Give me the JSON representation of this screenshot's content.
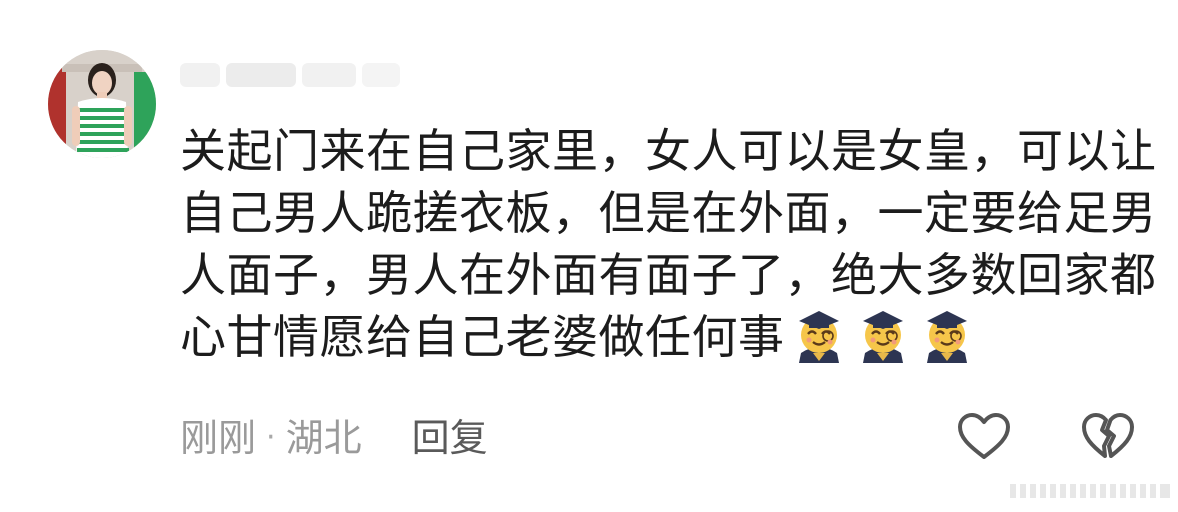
{
  "comment": {
    "username": "",
    "lines": [
      "关起门来在自己家里，女人可以是女皇，可以让",
      "自己男人跪搓衣板，但是在外面，一定要给足男",
      "人面子，男人在外面有面子了，绝大多数回家都",
      "心甘情愿给自己老婆做任何事"
    ],
    "emojis": [
      "scholar-smile-emoji",
      "scholar-smile-emoji",
      "scholar-smile-emoji"
    ],
    "time": "刚刚",
    "dot": "·",
    "location": "湖北",
    "reply_label": "回复",
    "like_icon": "heart-outline-icon",
    "dislike_icon": "broken-heart-outline-icon"
  },
  "colors": {
    "text": "#1c1c1c",
    "meta": "#9a9a9a",
    "reply": "#5a5a5a",
    "icon": "#555555",
    "avatar_stripe": "#2ea35a"
  }
}
